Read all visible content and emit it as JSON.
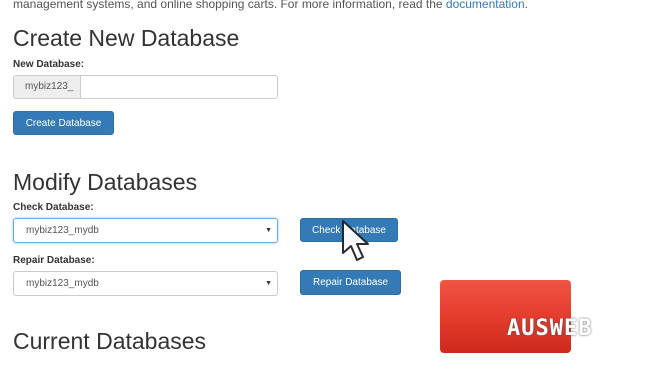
{
  "intro": {
    "text": "management systems, and online shopping carts. For more information, read the ",
    "link": "documentation",
    "end": "."
  },
  "create": {
    "heading": "Create New Database",
    "label": "New Database:",
    "prefix": "mybiz123_",
    "value": "",
    "button": "Create Database"
  },
  "modify": {
    "heading": "Modify Databases",
    "check_label": "Check Database:",
    "check_selected": "mybiz123_mydb",
    "check_button": "Check Database",
    "repair_label": "Repair Database:",
    "repair_selected": "mybiz123_mydb",
    "repair_button": "Repair Database"
  },
  "current": {
    "heading": "Current Databases"
  },
  "watermark": {
    "text": "AUSWEB"
  },
  "colors": {
    "primary_button": "#337ab7",
    "link": "#337ab7",
    "logo_red": "#e23a2b"
  },
  "icons": {
    "select_caret": "caret-down",
    "cursor": "mouse-pointer-arrow"
  }
}
